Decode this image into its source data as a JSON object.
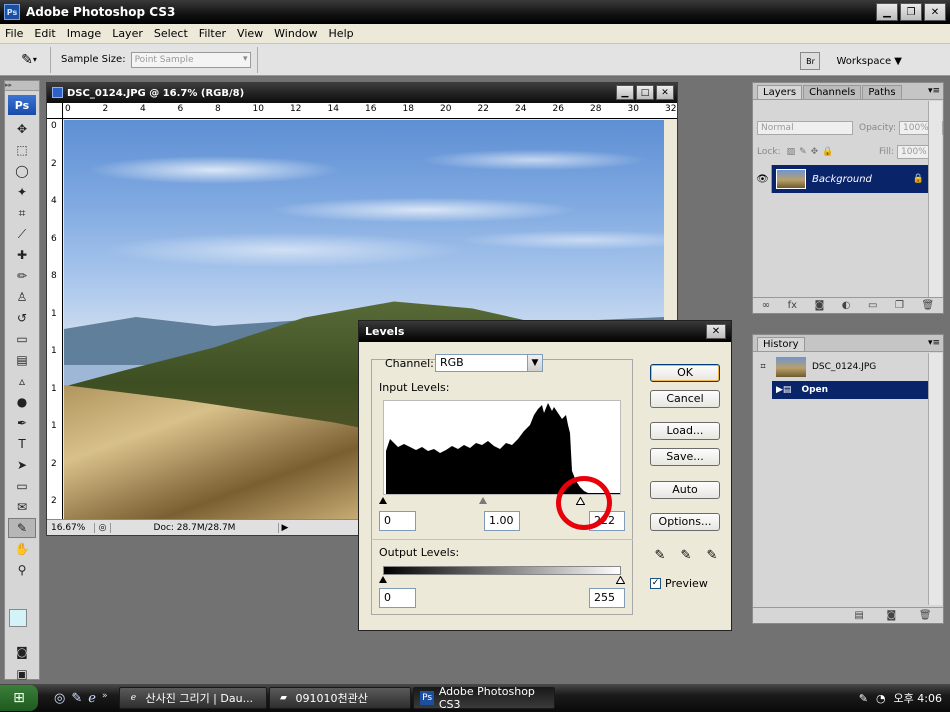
{
  "app": {
    "title": "Adobe Photoshop CS3",
    "icon": "ps-icon",
    "window_controls": [
      "minimize",
      "restore",
      "close"
    ]
  },
  "menu": [
    "File",
    "Edit",
    "Image",
    "Layer",
    "Select",
    "Filter",
    "View",
    "Window",
    "Help"
  ],
  "options_bar": {
    "tool_icon": "eyedropper-icon",
    "sample_size_label": "Sample Size:",
    "sample_size_value": "Point Sample",
    "workspace_label": "Workspace ▼",
    "bridge_icon": "bridge-icon"
  },
  "tools_panel": {
    "logo": "Ps",
    "tools": [
      "move-icon",
      "marquee-icon",
      "lasso-icon",
      "magic-wand-icon",
      "crop-icon",
      "slice-icon",
      "healing-brush-icon",
      "brush-icon",
      "clone-stamp-icon",
      "history-brush-icon",
      "eraser-icon",
      "gradient-icon",
      "blur-icon",
      "dodge-icon",
      "pen-icon",
      "type-icon",
      "path-select-icon",
      "shape-icon",
      "notes-icon",
      "eyedropper-icon",
      "hand-icon",
      "zoom-icon"
    ],
    "active_tool": "eyedropper-icon",
    "foreground_color": "#d3f3f8",
    "background_color": "#ffffff"
  },
  "document": {
    "title": "DSC_0124.JPG @ 16.7% (RGB/8)",
    "ruler_h": [
      "0",
      "2",
      "4",
      "6",
      "8",
      "10",
      "12",
      "14",
      "16",
      "18",
      "20",
      "22",
      "24",
      "26",
      "28",
      "30",
      "32"
    ],
    "ruler_v": [
      "0",
      "2",
      "4",
      "6",
      "8",
      "1",
      "1",
      "1",
      "1",
      "2",
      "2"
    ],
    "zoom": "16.67%",
    "status": "Doc: 28.7M/28.7M"
  },
  "levels_dialog": {
    "title": "Levels",
    "channel_label": "Channel:",
    "channel_value": "RGB",
    "input_levels_label": "Input Levels:",
    "input_black": "0",
    "input_gamma": "1.00",
    "input_white": "222",
    "output_levels_label": "Output Levels:",
    "output_black": "0",
    "output_white": "255",
    "buttons": {
      "ok": "OK",
      "cancel": "Cancel",
      "load": "Load...",
      "save": "Save...",
      "auto": "Auto",
      "options": "Options..."
    },
    "preview_label": "Preview",
    "preview_checked": true,
    "highlight_color": "#e8000b"
  },
  "layers_panel": {
    "tabs": [
      "Layers",
      "Channels",
      "Paths"
    ],
    "blend_mode": "Normal",
    "opacity_label": "Opacity:",
    "opacity_value": "100%",
    "lock_label": "Lock:",
    "fill_label": "Fill:",
    "fill_value": "100%",
    "layer_name": "Background"
  },
  "history_panel": {
    "tab": "History",
    "snapshot": "DSC_0124.JPG",
    "states": [
      "Open"
    ]
  },
  "taskbar": {
    "start_icon": "windows-start-icon",
    "tasks": [
      {
        "label": "산사진 그리기 | Dau...",
        "icon": "ie-icon"
      },
      {
        "label": "091010천관산",
        "icon": "folder-icon"
      },
      {
        "label": "Adobe Photoshop CS3",
        "icon": "ps-icon"
      }
    ],
    "clock": "오후 4:06"
  }
}
